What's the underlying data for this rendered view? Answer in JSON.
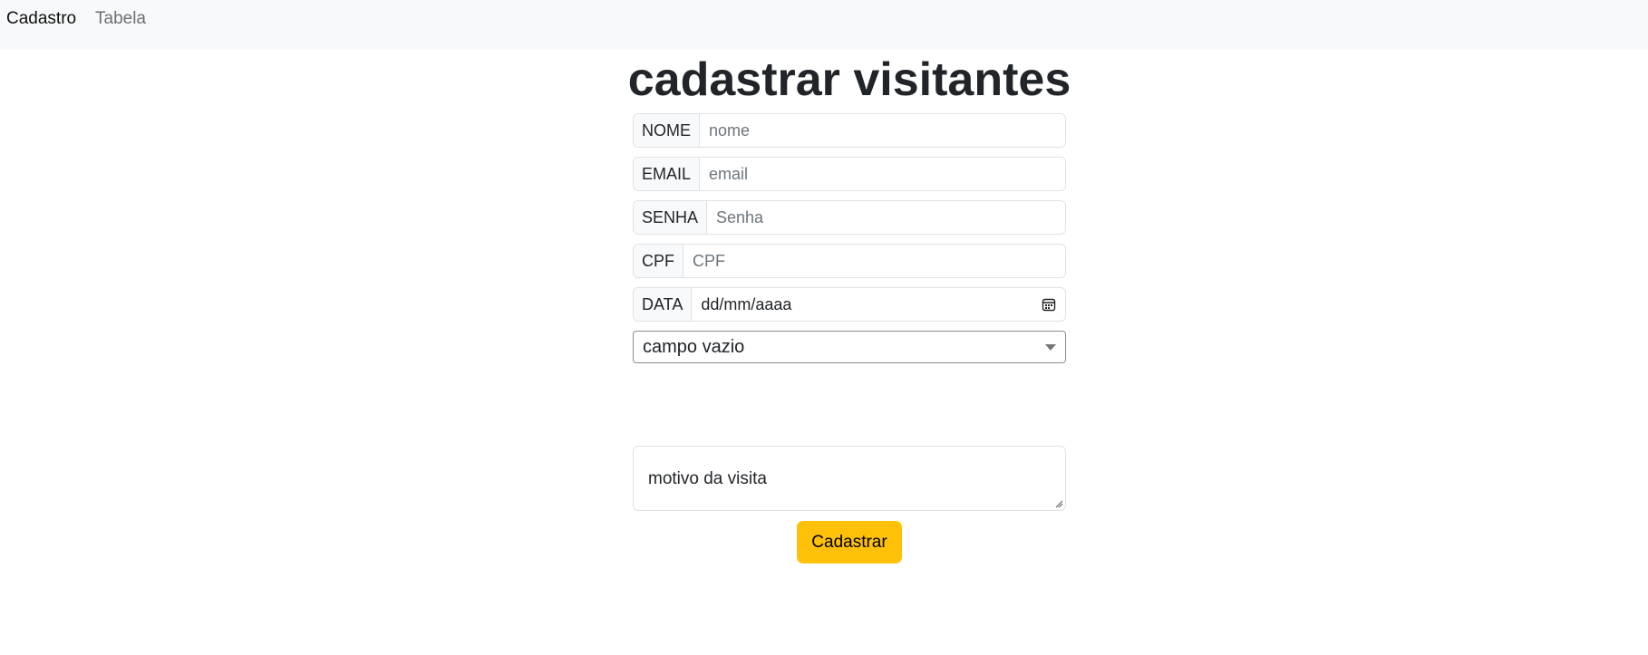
{
  "nav": {
    "brand": "Cadastro",
    "link": "Tabela"
  },
  "page": {
    "title": "cadastrar visitantes"
  },
  "form": {
    "nome": {
      "label": "NOME",
      "placeholder": "nome"
    },
    "email": {
      "label": "EMAIL",
      "placeholder": "email"
    },
    "senha": {
      "label": "SENHA",
      "placeholder": "Senha"
    },
    "cpf": {
      "label": "CPF",
      "placeholder": "CPF"
    },
    "data": {
      "label": "DATA",
      "value": "dd/mm/aaaa",
      "icon": "calendar-icon"
    },
    "select": {
      "value": "campo vazio"
    },
    "motivo": {
      "placeholder": "motivo da visita"
    },
    "submit_label": "Cadastrar"
  },
  "colors": {
    "navbar_bg": "#f8f9fa",
    "button_bg": "#ffc107",
    "border": "#dee2e6"
  }
}
